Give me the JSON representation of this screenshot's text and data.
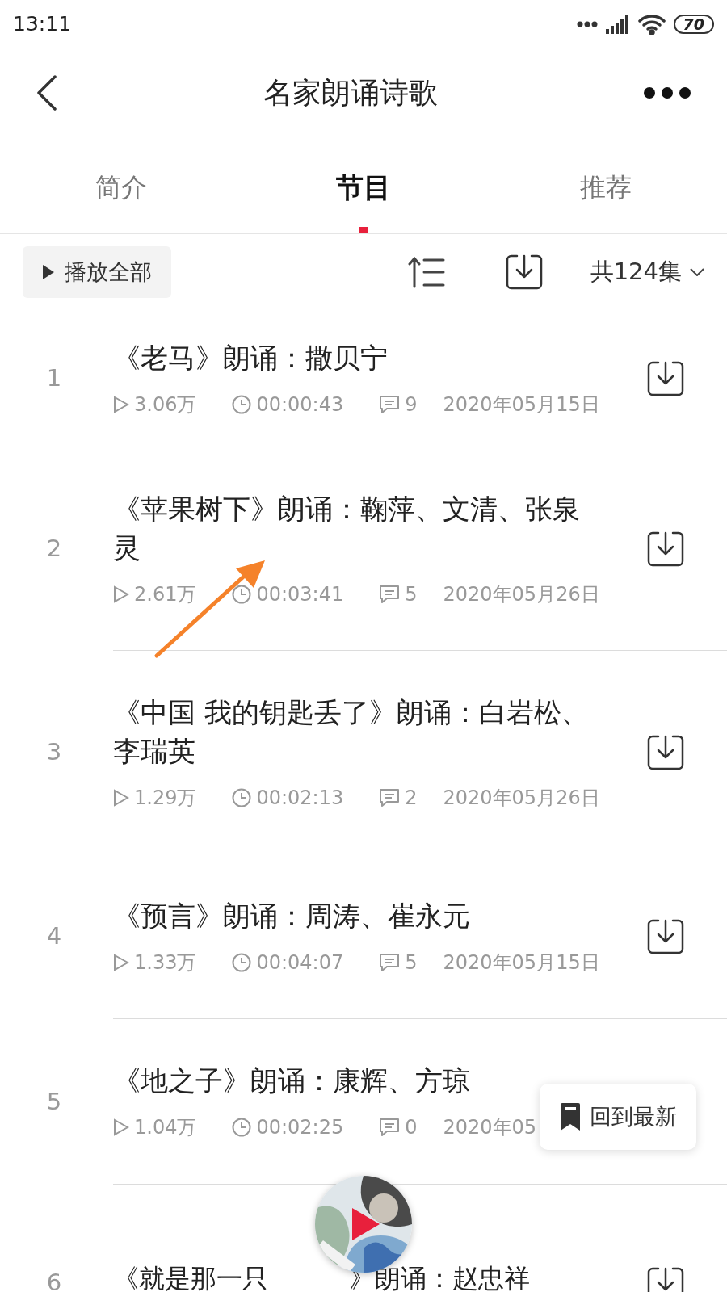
{
  "status_bar": {
    "time": "13:11",
    "battery": "70"
  },
  "header": {
    "title": "名家朗诵诗歌"
  },
  "tabs": [
    {
      "label": "简介",
      "selected": false
    },
    {
      "label": "节目",
      "selected": true
    },
    {
      "label": "推荐",
      "selected": false
    }
  ],
  "toolbar": {
    "play_all": "播放全部",
    "count": "共124集"
  },
  "episodes": [
    {
      "number": "1",
      "title": "《老马》朗诵：撒贝宁",
      "plays": "3.06万",
      "duration": "00:00:43",
      "comments": "9",
      "date": "2020年05月15日"
    },
    {
      "number": "2",
      "title": "《苹果树下》朗诵：鞠萍、文清、张泉灵",
      "plays": "2.61万",
      "duration": "00:03:41",
      "comments": "5",
      "date": "2020年05月26日"
    },
    {
      "number": "3",
      "title": "《中国 我的钥匙丢了》朗诵：白岩松、李瑞英",
      "plays": "1.29万",
      "duration": "00:02:13",
      "comments": "2",
      "date": "2020年05月26日"
    },
    {
      "number": "4",
      "title": "《预言》朗诵：周涛、崔永元",
      "plays": "1.33万",
      "duration": "00:04:07",
      "comments": "5",
      "date": "2020年05月15日"
    },
    {
      "number": "5",
      "title": "《地之子》朗诵：康辉、方琼",
      "plays": "1.04万",
      "duration": "00:02:25",
      "comments": "0",
      "date": "2020年05",
      "download_hidden": true
    },
    {
      "number": "6",
      "title": "《就是那一只",
      "title_after": "》朗诵：赵忠祥"
    }
  ],
  "back_to_latest": "回到最新"
}
